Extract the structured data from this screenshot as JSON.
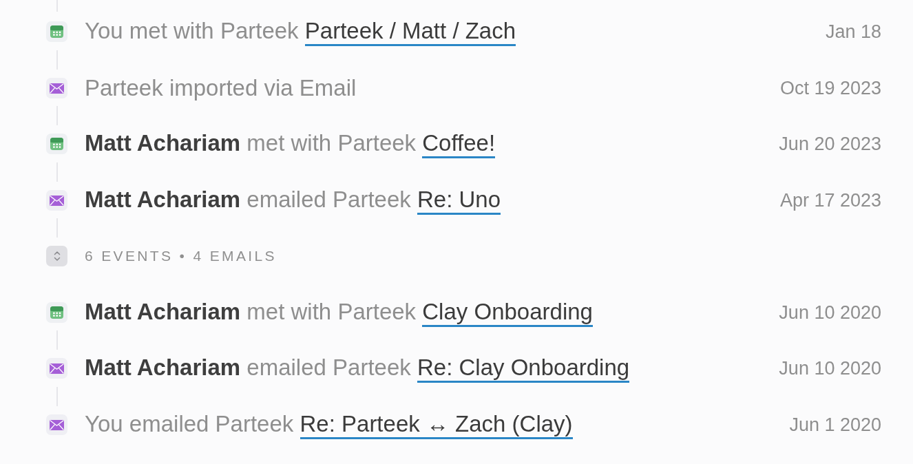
{
  "timeline": {
    "events": [
      {
        "kind": "meeting",
        "text": "You met with Parteek",
        "link": "Parteek / Matt / Zach",
        "date": "Jan 18"
      },
      {
        "kind": "email",
        "text": "Parteek imported via Email",
        "date": "Oct 19 2023"
      },
      {
        "kind": "meeting",
        "actor": "Matt Achariam",
        "text": "met with Parteek",
        "link": "Coffee!",
        "date": "Jun 20 2023"
      },
      {
        "kind": "email",
        "actor": "Matt Achariam",
        "text": "emailed Parteek",
        "link": "Re: Uno",
        "date": "Apr 17 2023"
      },
      {
        "kind": "collapsed",
        "label": "6 EVENTS • 4 EMAILS"
      },
      {
        "kind": "meeting",
        "actor": "Matt Achariam",
        "text": "met with Parteek",
        "link": "Clay Onboarding",
        "date": "Jun 10 2020"
      },
      {
        "kind": "email",
        "actor": "Matt Achariam",
        "text": "emailed Parteek",
        "link": "Re: Clay Onboarding",
        "date": "Jun 10 2020"
      },
      {
        "kind": "email",
        "text": "You emailed Parteek",
        "link": "Re: Parteek ↔ Zach (Clay)",
        "date": "Jun 1 2020"
      }
    ]
  }
}
